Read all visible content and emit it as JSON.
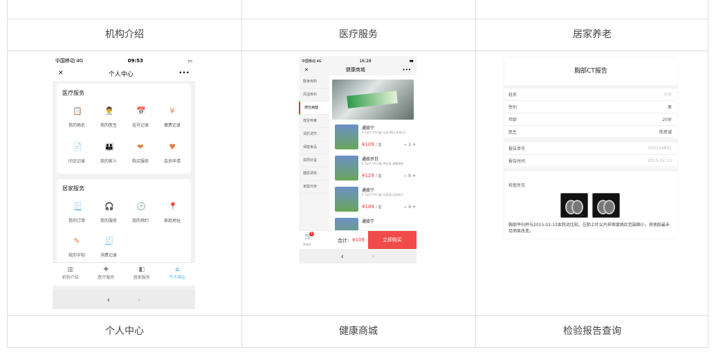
{
  "captions": {
    "org": "机构介绍",
    "med": "医疗服务",
    "home": "居家养老",
    "personal": "个人中心",
    "mall": "健康商城",
    "report": "检验报告查询"
  },
  "phone1": {
    "status": {
      "carrier": "中国移动 4G",
      "time": "09:53"
    },
    "nav": {
      "close": "✕",
      "title": "个人中心",
      "more": "•••"
    },
    "medical": {
      "title": "医疗服务",
      "items": [
        {
          "label": "我的病史",
          "icon": "📋"
        },
        {
          "label": "我的医生",
          "icon": "👨‍⚕️"
        },
        {
          "label": "挂号记录",
          "icon": "📅"
        },
        {
          "label": "缴费记录",
          "icon": "¥"
        },
        {
          "label": "问诊记录",
          "icon": "📄"
        },
        {
          "label": "我的家人",
          "icon": "👪"
        },
        {
          "label": "购买服务",
          "icon": "❤"
        },
        {
          "label": "会员申请",
          "icon": "♥"
        }
      ]
    },
    "home": {
      "title": "居家服务",
      "items": [
        {
          "label": "我的订单",
          "icon": "📃"
        },
        {
          "label": "我的服务",
          "icon": "🎧"
        },
        {
          "label": "我的预约",
          "icon": "🕑"
        },
        {
          "label": "家庭地址",
          "icon": "📍"
        },
        {
          "label": "我的字帖",
          "icon": "✎"
        },
        {
          "label": "消费记录",
          "icon": "🧾"
        }
      ]
    },
    "tabs": [
      {
        "label": "机构介绍",
        "icon": "▥"
      },
      {
        "label": "医疗服务",
        "icon": "✚"
      },
      {
        "label": "居家服务",
        "icon": "◧"
      },
      {
        "label": "个人中心",
        "icon": "⌂"
      }
    ],
    "back": "‹",
    "fwd": "›"
  },
  "phone2": {
    "status": {
      "carrier": "中国移动 4G",
      "time": "16:28"
    },
    "nav": {
      "close": "✕",
      "title": "健康商城",
      "more": "•••"
    },
    "side": [
      "膳食用药",
      "风湿骨科",
      "慢性病健",
      "感冒咳嗽",
      "清肝调节",
      "保健食品",
      "滋阴补益",
      "糖尿调体",
      "家庭日用"
    ],
    "products": [
      {
        "name": "通痰宁",
        "desc": "6.7g/片*0片/盒|\n化痰,降压,补肾(3)",
        "price": "¥109",
        "unit": "/ 盒",
        "qty": "1"
      },
      {
        "name": "通痰杀甘",
        "desc": "6.7g/片*0片/盒|\n降压安,调整疏经",
        "price": "¥129",
        "unit": "/ 盒",
        "qty": "0"
      },
      {
        "name": "通痰宁",
        "desc": "6.7g/片*0片/盒|\n化痰清,活血杂炎",
        "price": "¥189",
        "unit": "/ 盒",
        "qty": "0"
      },
      {
        "name": "通痰宁",
        "desc": "",
        "price": "",
        "unit": "",
        "qty": ""
      }
    ],
    "cart": {
      "label": "购物车",
      "badge": "1",
      "total_label": "合计:",
      "total": "¥109",
      "buy": "立即购买"
    },
    "back": "‹",
    "fwd": "›"
  },
  "report": {
    "title": "胸部CT报告",
    "fields": [
      {
        "k": "姓名",
        "v": "王华"
      },
      {
        "k": "性别",
        "v": "男"
      },
      {
        "k": "年龄",
        "v": "20岁"
      },
      {
        "k": "医生",
        "v": "陈思诚"
      },
      {
        "k": "报告单号",
        "v": "000126891"
      },
      {
        "k": "报告时间",
        "v": "2015-02-13"
      }
    ],
    "section": "检查所见",
    "text": "胸部平扫并与2015-02-13本院对比较。左肺上叶尖片样密度病灶范围缩小，其他胶最未见明显改变。"
  }
}
